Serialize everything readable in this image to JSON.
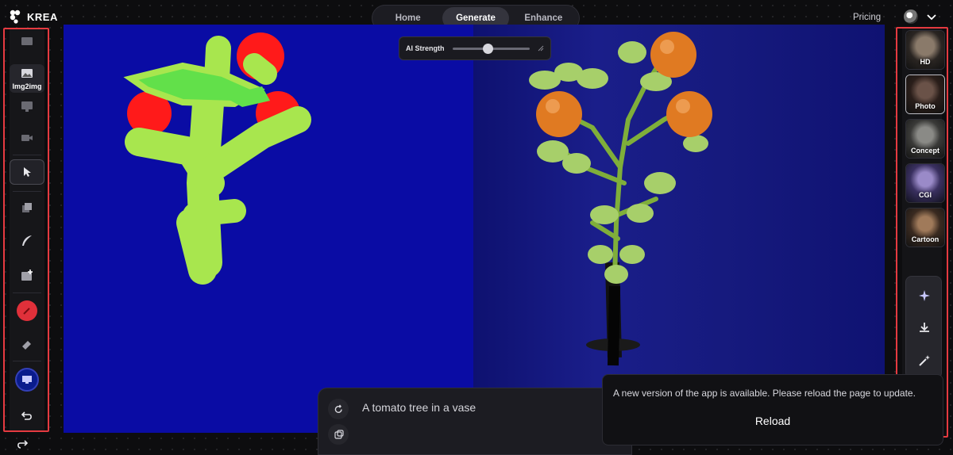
{
  "app": {
    "name": "KREA"
  },
  "topnav": {
    "tabs": [
      "Home",
      "Generate",
      "Enhance"
    ],
    "active": "Generate"
  },
  "header": {
    "pricing_label": "Pricing"
  },
  "left_toolbar": {
    "img2img_label": "Img2img"
  },
  "ai_strength": {
    "label": "AI Strength",
    "value": 0.46
  },
  "styles": {
    "items": [
      {
        "label": "HD"
      },
      {
        "label": "Photo"
      },
      {
        "label": "Concept"
      },
      {
        "label": "CGI"
      },
      {
        "label": "Cartoon"
      }
    ],
    "active": "Photo"
  },
  "prompt": {
    "text": "A tomato tree in a vase"
  },
  "toast": {
    "message": "A new version of the app is available. Please reload the page to update.",
    "reload_label": "Reload"
  },
  "colors": {
    "accent_red": "#e53a40",
    "canvas_blue": "#0a0ca4",
    "paint_green": "#a8e64e",
    "paint_red": "#ff1a1a"
  }
}
